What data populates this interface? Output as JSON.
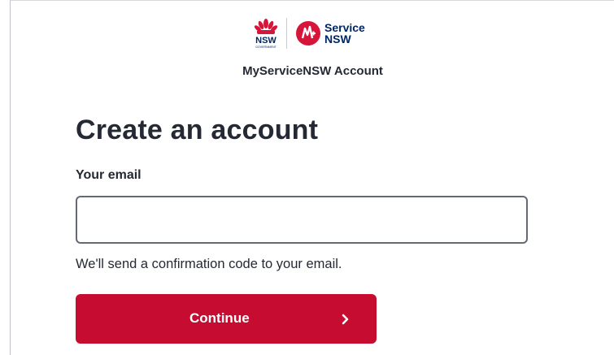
{
  "header": {
    "nsw_logo_text": "NSW",
    "nsw_logo_subtext": "GOVERNMENT",
    "service_logo_line1": "Service",
    "service_logo_line2": "NSW",
    "account_title": "MyServiceNSW Account"
  },
  "form": {
    "title": "Create an account",
    "email_label": "Your email",
    "email_value": "",
    "email_placeholder": "",
    "helper_text": "We'll send a confirmation code to your email.",
    "continue_label": "Continue",
    "continue_icon": "chevron-right-icon"
  },
  "colors": {
    "primary_red": "#c60c30",
    "navy": "#002664",
    "text": "#242934",
    "input_border": "#646974"
  }
}
